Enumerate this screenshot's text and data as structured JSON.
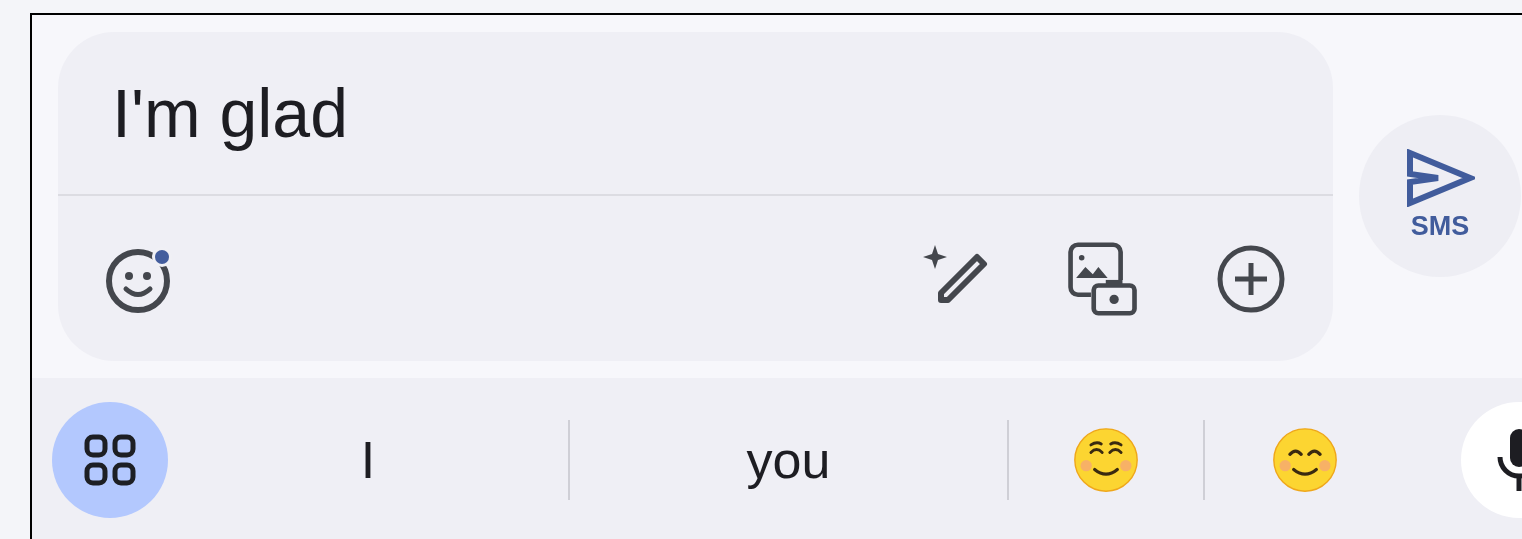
{
  "compose": {
    "value": "I'm glad",
    "emoji_badge": true,
    "send_label": "SMS"
  },
  "suggestions": [
    {
      "kind": "word",
      "text": "I"
    },
    {
      "kind": "word",
      "text": "you"
    },
    {
      "kind": "emoji"
    },
    {
      "kind": "emoji"
    }
  ]
}
